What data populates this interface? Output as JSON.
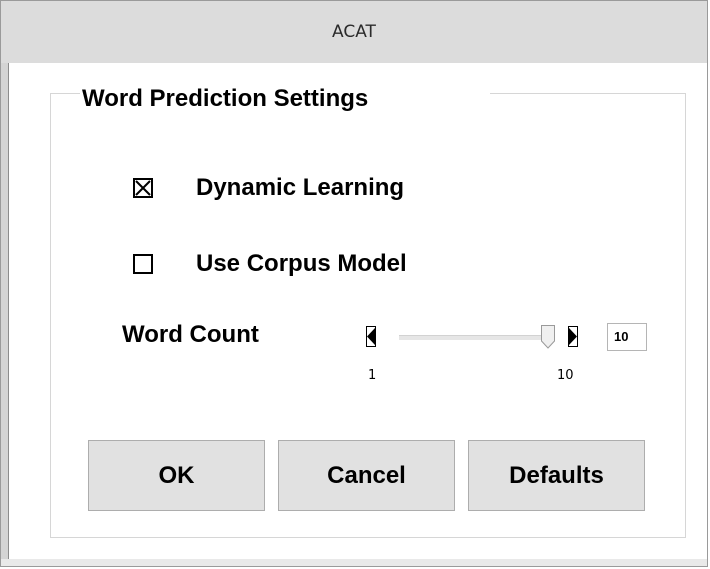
{
  "window": {
    "title": "ACAT"
  },
  "settings": {
    "group_title": "Word Prediction Settings",
    "dynamic_learning": {
      "label": "Dynamic Learning",
      "checked": true
    },
    "use_corpus_model": {
      "label": "Use Corpus Model",
      "checked": false
    },
    "word_count": {
      "label": "Word Count",
      "min_label": "1",
      "max_label": "10",
      "value": "10",
      "min": 1,
      "max": 10
    }
  },
  "buttons": {
    "ok": "OK",
    "cancel": "Cancel",
    "defaults": "Defaults"
  },
  "icons": {
    "checked_box": "checkbox-checked-icon",
    "unchecked_box": "checkbox-unchecked-icon",
    "decrease": "slider-decrease-icon",
    "increase": "slider-increase-icon"
  }
}
